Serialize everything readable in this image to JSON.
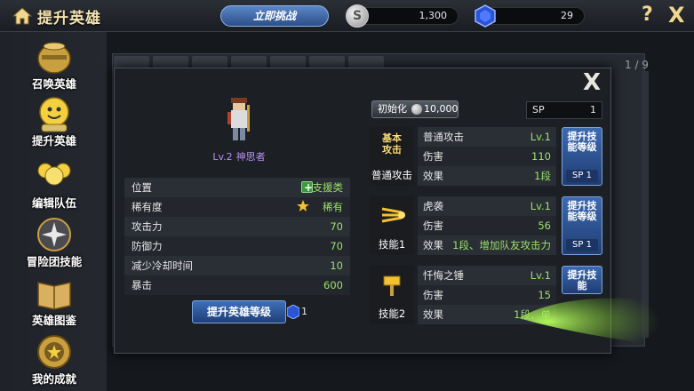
{
  "header": {
    "title": "提升英雄",
    "challenge_label": "立即挑战",
    "silver_symbol": "S",
    "silver_amount": "1,300",
    "gem_amount": "29",
    "help_label": "?",
    "close_label": "X"
  },
  "sidebar": {
    "items": [
      {
        "label": "召唤英雄",
        "icon": "summon-jar-icon"
      },
      {
        "label": "提升英雄",
        "icon": "level-up-icon"
      },
      {
        "label": "编辑队伍",
        "icon": "team-icon"
      },
      {
        "label": "冒险团技能",
        "icon": "guild-skill-icon"
      },
      {
        "label": "英雄图鉴",
        "icon": "book-icon"
      },
      {
        "label": "我的成就",
        "icon": "medal-icon"
      }
    ]
  },
  "background": {
    "pager": "1 / 9"
  },
  "modal": {
    "close_label": "X",
    "hero": {
      "level": "Lv.2",
      "name": "神思者"
    },
    "stats": [
      {
        "key": "位置",
        "value": "支援类"
      },
      {
        "key": "稀有度",
        "value": "稀有"
      },
      {
        "key": "攻击力",
        "value": "70"
      },
      {
        "key": "防御力",
        "value": "70"
      },
      {
        "key": "减少冷却时间",
        "value": "10"
      },
      {
        "key": "暴击",
        "value": "600"
      }
    ],
    "upgrade_label": "提升英雄等级",
    "upgrade_cost": "1",
    "init_label": "初始化",
    "init_cost": "10,000",
    "sp_label": "SP",
    "sp_value": "1",
    "skills": [
      {
        "badge_text": "基本攻击",
        "badge_label": "普通攻击",
        "name": "普通攻击",
        "level": "Lv.1",
        "dmg_key": "伤害",
        "dmg": "110",
        "eff_key": "效果",
        "effect": "1段",
        "up_label": "提升技能等级",
        "up_sp": "SP 1"
      },
      {
        "badge_label": "技能1",
        "name": "虎袭",
        "level": "Lv.1",
        "dmg_key": "伤害",
        "dmg": "56",
        "eff_key": "效果",
        "effect": "1段、增加队友攻击力",
        "up_label": "提升技能等级",
        "up_sp": "SP 1"
      },
      {
        "badge_label": "技能2",
        "name": "忏悔之锤",
        "level": "Lv.1",
        "dmg_key": "伤害",
        "dmg": "15",
        "eff_key": "效果",
        "effect": "1段、单",
        "up_label": "提升技能",
        "up_sp": ""
      }
    ]
  },
  "colors": {
    "accent_green": "#9be26a",
    "button_blue": "#2d4f86",
    "gold_text": "#f3e3b0"
  }
}
